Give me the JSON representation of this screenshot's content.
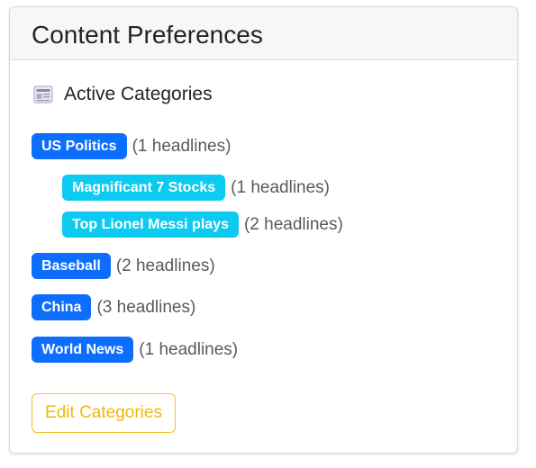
{
  "header": {
    "title": "Content Preferences"
  },
  "section": {
    "icon": "newspaper-icon",
    "title": "Active Categories"
  },
  "categories": [
    {
      "label": "US Politics",
      "count_text": "(1 headlines)",
      "style": "primary",
      "level": 0
    },
    {
      "label": "Magnificant 7 Stocks",
      "count_text": "(1 headlines)",
      "style": "info",
      "level": 1
    },
    {
      "label": "Top Lionel Messi plays",
      "count_text": "(2 headlines)",
      "style": "info",
      "level": 1
    },
    {
      "label": "Baseball",
      "count_text": "(2 headlines)",
      "style": "primary",
      "level": 0
    },
    {
      "label": "China",
      "count_text": "(3 headlines)",
      "style": "primary",
      "level": 0
    },
    {
      "label": "World News",
      "count_text": "(1 headlines)",
      "style": "primary",
      "level": 0
    }
  ],
  "actions": {
    "edit_label": "Edit Categories"
  },
  "colors": {
    "primary": "#0d6efd",
    "info": "#0dcaf0",
    "warning": "#f0b90b"
  }
}
